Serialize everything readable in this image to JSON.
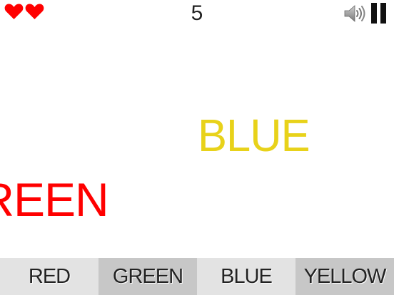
{
  "hud": {
    "lives": 2,
    "lives_icon": "heart-icon",
    "lives_color": "#ff0000",
    "score": "5",
    "sound_icon": "speaker-icon",
    "pause_icon": "pause-icon"
  },
  "words": [
    {
      "text": "BLUE",
      "color": "#e8d21a"
    },
    {
      "text": "GREEN",
      "color": "#ff0000"
    }
  ],
  "answers": [
    {
      "label": "RED"
    },
    {
      "label": "GREEN"
    },
    {
      "label": "BLUE"
    },
    {
      "label": "YELLOW"
    }
  ],
  "colors": {
    "background": "#ffffff",
    "answer_light": "#e3e3e3",
    "answer_dark": "#c7c7c7"
  }
}
